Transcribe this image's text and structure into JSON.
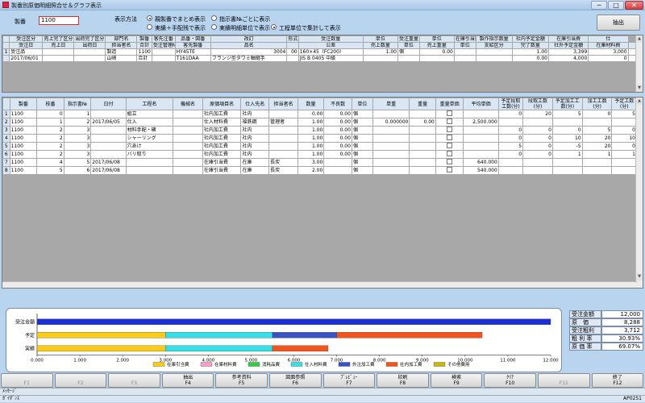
{
  "window": {
    "title": "製番別原価明細照合せ＆グラフ表示",
    "min": "─",
    "max": "□",
    "close": "✕"
  },
  "top": {
    "seiban_label": "製番",
    "seiban_value": "1100",
    "display_method_label": "表示方法",
    "radios": [
      {
        "label": "親製番でまとめ表示",
        "checked": true
      },
      {
        "label": "指示書№ごとに表示",
        "checked": false
      },
      {
        "label": "実績＋手配残で表示",
        "checked": false
      },
      {
        "label": "実績明細単位で表示",
        "checked": false
      },
      {
        "label": "工程単位で集計して表示",
        "checked": true
      }
    ],
    "extract_button": "抽出"
  },
  "order_grid": {
    "header1": [
      "受注区分",
      "売上完了区分",
      "出荷完了区分",
      "部門名",
      "製番",
      "客先注番",
      "品番・図番",
      "改訂",
      "形式・寸法",
      "受注数量",
      "単位",
      "受注重量",
      "単位",
      "在庫引当数量",
      "製作指示数量",
      "社内予定金額",
      "在庫引当費",
      "仕"
    ],
    "header2": [
      "受注日",
      "売上日",
      "出荷日",
      "担当者名",
      "合計",
      "受注管理№",
      "客先製番",
      "品名",
      "",
      "公差",
      "売上数量",
      "単位",
      "売上重量",
      "単位",
      "支給区分",
      "完了数量",
      "社外予定金額",
      "在庫材料費",
      ""
    ],
    "rows": [
      {
        "num": "1",
        "l1": [
          "受注品",
          "",
          "",
          "製造",
          "1100",
          "",
          "HY45TE",
          "3004",
          "00",
          "160×45（FC200）",
          "1.00",
          "個",
          "0.00",
          "",
          "",
          "1.00",
          "3,399",
          "3,000",
          ""
        ],
        "l2": [
          "2017/06/01",
          "",
          "",
          "山崎",
          "合計",
          "",
          "T161DAA",
          "フランジ型タワミ軸継手",
          "",
          "JIS B 0405 中級",
          "",
          "",
          "",
          "",
          "",
          "0.00",
          "4,000",
          "0",
          ""
        ]
      }
    ]
  },
  "detail_grid": {
    "headers": [
      "製番",
      "枝番",
      "指示書№",
      "日付",
      "工程名",
      "機械名",
      "原価項目名",
      "仕入先名",
      "担当者名",
      "数量",
      "不良数",
      "単位",
      "単重",
      "重量",
      "重量単価",
      "平均単価",
      "予定段取工数(分)",
      "段取工数(分)",
      "予定加工工数(分)",
      "加工工数(分)",
      "予定工数(分)"
    ],
    "rows": [
      {
        "num": "1",
        "cells": [
          "1100",
          "0",
          "1",
          "",
          "組立",
          "",
          "社内加工費",
          "社内",
          "",
          "0.00",
          "0.00",
          "個",
          "",
          "",
          "",
          "",
          "0",
          "20",
          "5",
          "0",
          "5"
        ]
      },
      {
        "num": "2",
        "cells": [
          "1100",
          "1",
          "2",
          "2017/06/05",
          "仕入",
          "",
          "仕入材料費",
          "福鉄鋼",
          "管理者",
          "1.00",
          "0.00",
          "個",
          "0.000000",
          "0.00",
          "",
          "2,500.000",
          "",
          "",
          "",
          "",
          ""
        ]
      },
      {
        "num": "3",
        "cells": [
          "1100",
          "2",
          "3",
          "",
          "材料手配・確",
          "",
          "社内加工費",
          "社内",
          "",
          "1.00",
          "0.00",
          "個",
          "",
          "",
          "",
          "",
          "0",
          "0",
          "0",
          "5",
          "0"
        ]
      },
      {
        "num": "4",
        "cells": [
          "1100",
          "2",
          "3",
          "",
          "シャーリング",
          "",
          "社内加工費",
          "社内",
          "",
          "1.00",
          "0.00",
          "個",
          "",
          "",
          "",
          "",
          "0",
          "0",
          "10",
          "20",
          "10"
        ]
      },
      {
        "num": "5",
        "cells": [
          "1100",
          "2",
          "3",
          "",
          "穴あけ",
          "",
          "社内加工費",
          "社内",
          "",
          "1.00",
          "0.00",
          "個",
          "",
          "",
          "",
          "",
          "5",
          "0",
          "-5",
          "20",
          "0"
        ]
      },
      {
        "num": "6",
        "cells": [
          "1100",
          "2",
          "3",
          "",
          "バリ取り",
          "",
          "社内加工費",
          "社内",
          "",
          "1.00",
          "0.00",
          "個",
          "",
          "",
          "",
          "",
          "0",
          "0",
          "1",
          "1",
          "1"
        ]
      },
      {
        "num": "7",
        "cells": [
          "1100",
          "4",
          "5",
          "2017/06/08",
          "",
          "",
          "在庫引当費",
          "在庫",
          "長炭",
          "3.00",
          "",
          "個",
          "",
          "",
          "",
          "640.000",
          "",
          "",
          "",
          "",
          ""
        ]
      },
      {
        "num": "8",
        "cells": [
          "1100",
          "5",
          "6",
          "2017/06/08",
          "",
          "",
          "在庫引当費",
          "在庫",
          "長炭",
          "2.00",
          "",
          "個",
          "",
          "",
          "",
          "540.000",
          "",
          "",
          "",
          "",
          ""
        ]
      }
    ]
  },
  "chart_data": {
    "type": "bar",
    "orientation": "horizontal",
    "stacked": true,
    "categories": [
      "受注金額",
      "予定",
      "実績"
    ],
    "xlim": [
      0,
      12
    ],
    "xticks": [
      "0.000",
      "1.000",
      "2.000",
      "3.000",
      "4.000",
      "5.000",
      "6.000",
      "7.000",
      "8.000",
      "9.000",
      "10.000",
      "11.000",
      "12.000"
    ],
    "series": [
      {
        "name": "受注金額",
        "color": "#1c2fd6",
        "values": [
          12.0,
          0,
          0
        ],
        "legend": false
      },
      {
        "name": "在庫引当費",
        "color": "#ffcc11",
        "values": [
          0,
          3.0,
          3.0
        ],
        "legend": true
      },
      {
        "name": "在庫材料費",
        "color": "#ff9ec8",
        "values": [
          0,
          0,
          0
        ],
        "legend": true
      },
      {
        "name": "消耗品費",
        "color": "#33cc44",
        "values": [
          0,
          0,
          0
        ],
        "legend": true
      },
      {
        "name": "仕入材料費",
        "color": "#33e0e8",
        "values": [
          0,
          2.5,
          2.5
        ],
        "legend": true
      },
      {
        "name": "外注加工費",
        "color": "#3a52c8",
        "values": [
          0,
          1.5,
          0
        ],
        "legend": true
      },
      {
        "name": "社内加工費",
        "color": "#f4541a",
        "values": [
          0,
          3.4,
          1.3
        ],
        "legend": true
      },
      {
        "name": "その他費用",
        "color": "#c8b800",
        "values": [
          0,
          0,
          0
        ],
        "legend": true
      }
    ]
  },
  "summary": [
    {
      "label": "受注金額",
      "value": "12,000"
    },
    {
      "label": "原　価",
      "value": "8,288"
    },
    {
      "label": "受注粗利",
      "value": "3,712"
    },
    {
      "label": "粗 利 率",
      "value": "30.93%"
    },
    {
      "label": "原 価 率",
      "value": "69.07%"
    }
  ],
  "fkeys": [
    {
      "label": "",
      "key": "F1",
      "enabled": false
    },
    {
      "label": "",
      "key": "F2",
      "enabled": false
    },
    {
      "label": "",
      "key": "F3",
      "enabled": false
    },
    {
      "label": "抽出",
      "key": "F4",
      "enabled": true
    },
    {
      "label": "参考資料",
      "key": "F5",
      "enabled": true
    },
    {
      "label": "図面参照",
      "key": "F6",
      "enabled": true
    },
    {
      "label": "ﾌﾟﾚﾋﾞｭｰ",
      "key": "F7",
      "enabled": true
    },
    {
      "label": "印刷",
      "key": "F8",
      "enabled": true
    },
    {
      "label": "検索",
      "key": "F9",
      "enabled": true
    },
    {
      "label": "ｸﾘｱ",
      "key": "F10",
      "enabled": true
    },
    {
      "label": "",
      "key": "F11",
      "enabled": false
    },
    {
      "label": "終了",
      "key": "F12",
      "enabled": true
    }
  ],
  "status": {
    "message_label": "ﾒｯｾｰｼﾞ",
    "guidance_label": "ｶﾞｲﾀﾞﾝｽ",
    "program_id": "AP0251"
  }
}
